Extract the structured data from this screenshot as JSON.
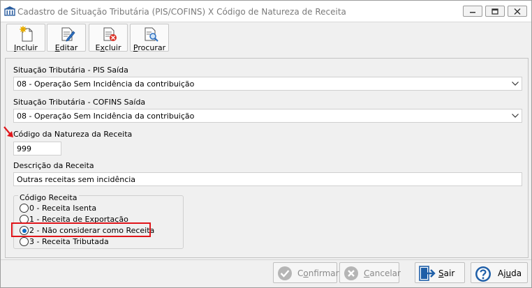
{
  "window": {
    "title": "Cadastro de Situação Tributária (PIS/COFINS) X Código de Natureza de Receita"
  },
  "toolbar": {
    "incluir": {
      "prefix": "",
      "accel": "I",
      "rest": "ncluir",
      "icon": "new-document-icon"
    },
    "editar": {
      "prefix": "",
      "accel": "E",
      "rest": "ditar",
      "icon": "edit-document-icon"
    },
    "excluir": {
      "prefix": "E",
      "accel": "x",
      "rest": "cluir",
      "icon": "delete-document-icon"
    },
    "procurar": {
      "prefix": "",
      "accel": "P",
      "rest": "rocurar",
      "icon": "search-document-icon"
    }
  },
  "form": {
    "pis_label": "Situação Tributária - PIS Saída",
    "pis_value": "08 - Operação Sem Incidência da contribuição",
    "cofins_label": "Situação Tributária - COFINS Saída",
    "cofins_value": "08 - Operação Sem Incidência da contribuição",
    "natureza_label": "Código da Natureza da Receita",
    "natureza_value": "999",
    "descricao_label": "Descrição da Receita",
    "descricao_value": "Outras receitas sem incidência"
  },
  "codigo_receita": {
    "title": "Código Receita",
    "options": [
      {
        "label": "0 - Receita Isenta",
        "selected": false
      },
      {
        "label": "1 - Receita de Exportação",
        "selected": false
      },
      {
        "label": "2 - Não considerar como Receita",
        "selected": true
      },
      {
        "label": "3 - Receita Tributada",
        "selected": false
      }
    ]
  },
  "buttons": {
    "confirmar": {
      "prefix": "C",
      "accel": "o",
      "rest": "nfirmar",
      "enabled": false
    },
    "cancelar": {
      "prefix": "",
      "accel": "C",
      "rest": "ancelar",
      "enabled": false
    },
    "sair": {
      "prefix": "",
      "accel": "S",
      "rest": "air",
      "enabled": true
    },
    "ajuda": {
      "prefix": "Aj",
      "accel": "u",
      "rest": "da",
      "enabled": true
    }
  },
  "colors": {
    "highlight": "#e0151a",
    "radio_selected": "#0d6bc4",
    "confirm_icon_disabled": "#a8a8a8",
    "exit_icon": "#1f5fa8",
    "help_icon": "#1f5fa8"
  }
}
